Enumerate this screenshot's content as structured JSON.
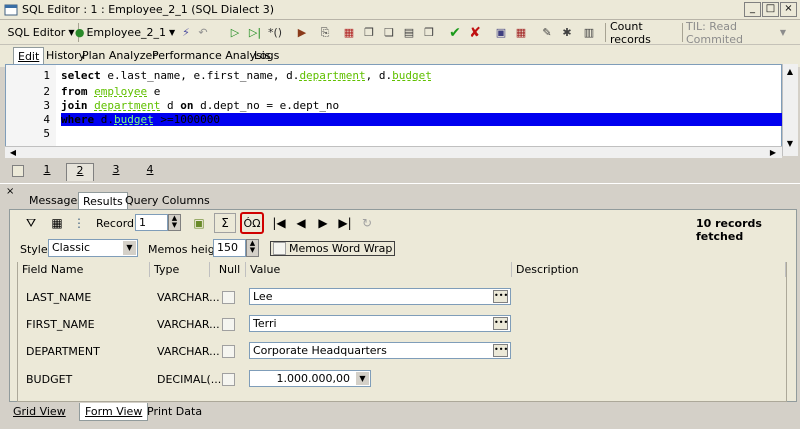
{
  "window": {
    "title": "SQL Editor : 1 : Employee_2_1 (SQL Dialect 3)",
    "btn_min": "_",
    "btn_max": "□",
    "btn_close": "×"
  },
  "toolbar": {
    "sql_editor": "SQL Editor",
    "database": "Employee_2_1",
    "count_records": "Count records",
    "isolation": "TIL: Read Commited"
  },
  "tabs": [
    "Edit",
    "History",
    "Plan Analyzer",
    "Performance Analysis",
    "Logs"
  ],
  "editor": {
    "line_numbers": [
      "1",
      "2",
      "3",
      "4",
      "5"
    ],
    "lines": [
      [
        "select",
        " e.last_name, e.first_name, d.",
        "department",
        ", d.",
        "budget"
      ],
      [
        "from",
        " ",
        "employee",
        " e"
      ],
      [
        "join",
        " ",
        "department",
        " d ",
        "on",
        " d.dept_no = e.dept_no"
      ],
      [
        "where",
        " d.",
        "budget",
        " >=1000000"
      ]
    ]
  },
  "page_tabs": [
    "1",
    "2",
    "3",
    "4"
  ],
  "results_tabs": [
    "Messages",
    "Results",
    "Query Columns"
  ],
  "results_toolbar": {
    "record_label": "Record:",
    "record_value": "1",
    "sigma": "Σ",
    "omega": "ÓΩ",
    "records_fetched": "10 records fetched"
  },
  "style_row": {
    "style_label": "Style:",
    "style_value": "Classic",
    "memos_height_label": "Memos height:",
    "memos_height_value": "150",
    "memos_word_wrap": "Memos Word Wrap"
  },
  "grid": {
    "headers": [
      "Field Name",
      "Type",
      "Null",
      "Value",
      "Description"
    ],
    "rows": [
      {
        "field": "LAST_NAME",
        "type": "VARCHAR...",
        "value": "Lee"
      },
      {
        "field": "FIRST_NAME",
        "type": "VARCHAR...",
        "value": "Terri"
      },
      {
        "field": "DEPARTMENT",
        "type": "VARCHAR...",
        "value": "Corporate Headquarters"
      },
      {
        "field": "BUDGET",
        "type": "DECIMAL(...",
        "value": "1.000.000,00"
      }
    ]
  },
  "bottom_tabs": [
    "Grid View",
    "Form View",
    "Print Data"
  ],
  "colors": {
    "selection": "#0000f0",
    "identifier": "#60c000",
    "number": "#c00000",
    "highlight_border": "#d00000"
  }
}
